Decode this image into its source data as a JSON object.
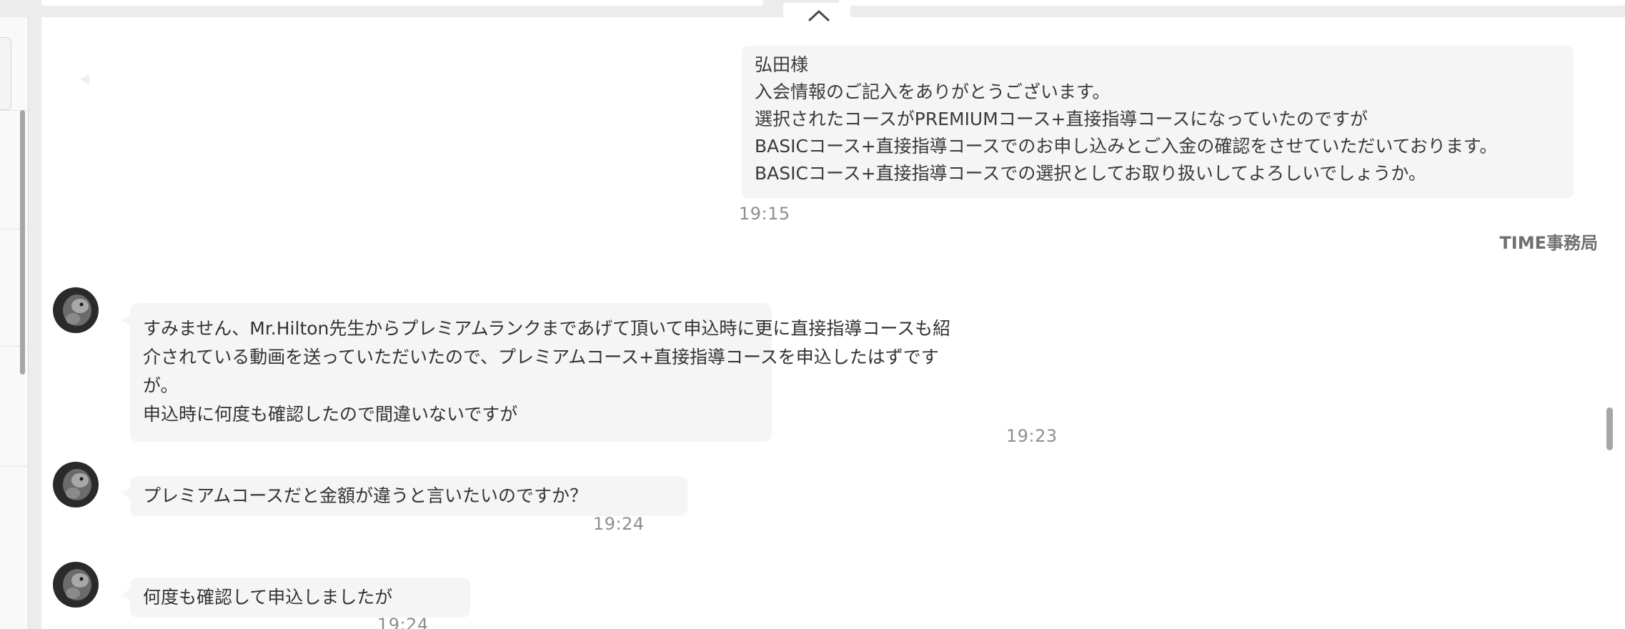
{
  "colors": {
    "bubble_bg": "#f5f5f5",
    "panel_bg": "#ffffff",
    "app_bg": "#ececec",
    "timestamp": "#8e8e8e",
    "sender_label": "#707070"
  },
  "icons": {
    "collapse": "chevron-up-icon",
    "back": "triangle-left-icon",
    "avatar": "user-avatar-photo"
  },
  "outgoing": {
    "lines": [
      "弘田様",
      "入会情報のご記入をありがとうございます。",
      "選択されたコースがPREMIUMコース+直接指導コースになっていたのですが",
      "BASICコース+直接指導コースでのお申し込みとご入金の確認をさせていただいております。",
      "BASICコース+直接指導コースでの選択としてお取り扱いしてよろしいでしょうか。"
    ],
    "time": "19:15",
    "sender": "TIME事務局"
  },
  "incoming": [
    {
      "lines": [
        "すみません、Mr.Hilton先生からプレミアムランクまであげて頂いて申込時に更に直接指導コースも紹",
        "介されている動画を送っていただいたので、プレミアムコース+直接指導コースを申込したはずです",
        "が。",
        "申込時に何度も確認したので間違いないですが"
      ],
      "time": "19:23"
    },
    {
      "lines": [
        "プレミアムコースだと金額が違うと言いたいのですか？"
      ],
      "time": "19:24"
    },
    {
      "lines": [
        "何度も確認して申込しましたが"
      ],
      "time": "19:24"
    }
  ]
}
